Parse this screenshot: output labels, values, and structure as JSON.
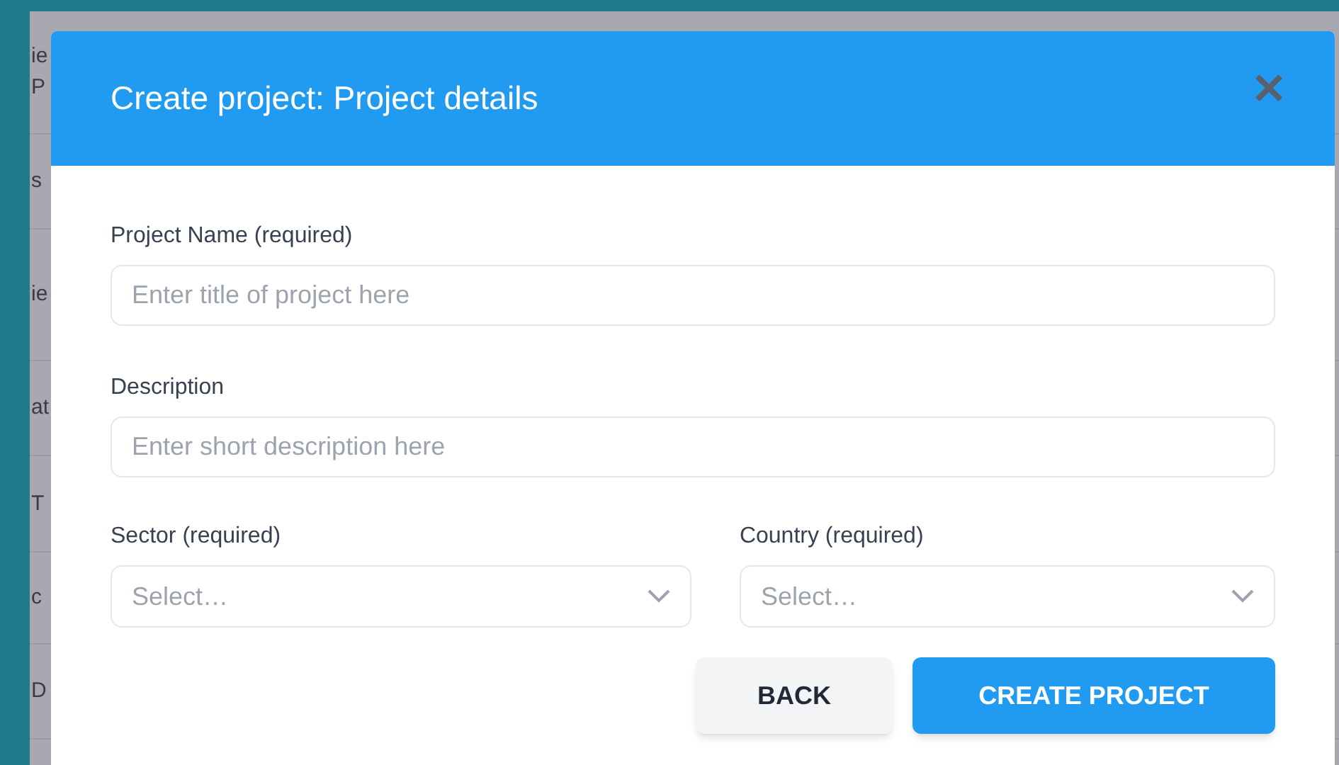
{
  "background_page": {
    "row_fragments": [
      [
        "ie",
        "P"
      ],
      [
        "s"
      ],
      [
        "ie"
      ],
      [
        "at"
      ],
      [
        "T"
      ],
      [
        "c"
      ],
      [
        "D"
      ]
    ]
  },
  "modal": {
    "title": "Create project: Project details",
    "close": "✕",
    "fields": [
      {
        "label": "Project Name (required)",
        "placeholder": "Enter title of project here"
      },
      {
        "label": "Description",
        "placeholder": "Enter short description here"
      }
    ],
    "selects": [
      {
        "label": "Sector (required)",
        "placeholder": "Select…"
      },
      {
        "label": "Country (required)",
        "placeholder": "Select…"
      }
    ],
    "buttons": [
      {
        "kind": "secondary",
        "label": "BACK"
      },
      {
        "kind": "primary",
        "label": "CREATE PROJECT"
      }
    ]
  }
}
